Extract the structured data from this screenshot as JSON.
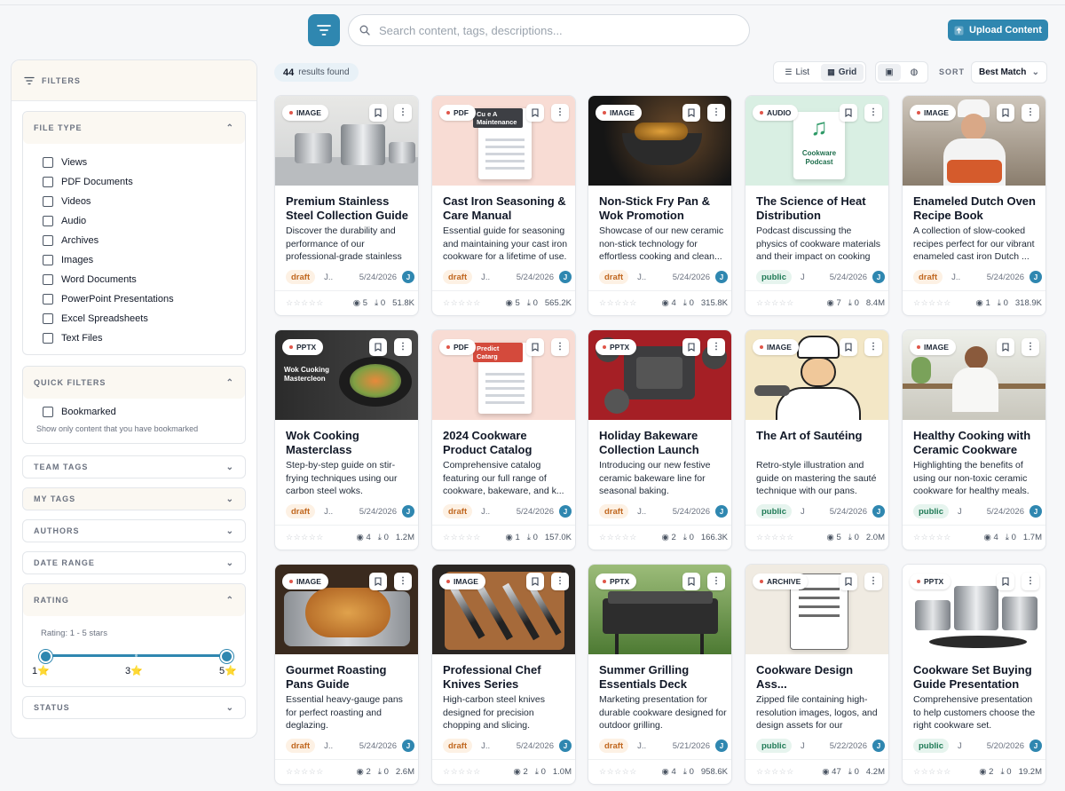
{
  "header": {
    "search_placeholder": "Search content, tags, descriptions...",
    "upload_label": "Upload Content"
  },
  "sidebar": {
    "title": "FILTERS",
    "file_type": {
      "title": "FILE TYPE",
      "options": [
        "Views",
        "PDF Documents",
        "Videos",
        "Audio",
        "Archives",
        "Images",
        "Word Documents",
        "PowerPoint Presentations",
        "Excel Spreadsheets",
        "Text Files"
      ]
    },
    "quick_filters": {
      "title": "QUICK FILTERS",
      "option": "Bookmarked",
      "hint": "Show only content that you have bookmarked"
    },
    "collapsed": [
      "TEAM TAGS",
      "MY TAGS",
      "AUTHORS",
      "DATE RANGE"
    ],
    "rating": {
      "title": "RATING",
      "label": "Rating: 1 - 5 stars",
      "min": "1⭐",
      "mid": "3⭐",
      "max": "5⭐",
      "range": [
        1,
        5
      ]
    },
    "status_title": "STATUS"
  },
  "toolbar": {
    "results_count": "44",
    "results_label": "results found",
    "list_label": "List",
    "grid_label": "Grid",
    "sort_label": "SORT",
    "sort_value": "Best Match"
  },
  "cards": [
    {
      "type": "IMAGE",
      "title": "Premium Stainless Steel Collection Guide",
      "desc": "Discover the durability and performance of our professional-grade stainless steel pots and pans.",
      "status": "draft",
      "author": "J..",
      "date": "5/24/2026",
      "views": "5",
      "downloads": "0",
      "size": "51.8K",
      "thumb_icon": "cookware-photo",
      "thumb_text": ""
    },
    {
      "type": "PDF",
      "title": "Cast Iron Seasoning & Care Manual",
      "desc": "Essential guide for seasoning and maintaining your cast iron cookware for a lifetime of use.",
      "status": "draft",
      "author": "J..",
      "date": "5/24/2026",
      "views": "5",
      "downloads": "0",
      "size": "565.2K",
      "thumb_icon": "document-icon",
      "thumb_text": "Cu e A Maintenance"
    },
    {
      "type": "IMAGE",
      "title": "Non-Stick Fry Pan & Wok Promotion",
      "desc": "Showcase of our new ceramic non-stick technology for effortless cooking and clean...",
      "status": "draft",
      "author": "J..",
      "date": "5/24/2026",
      "views": "4",
      "downloads": "0",
      "size": "315.8K",
      "thumb_icon": "wok-photo",
      "thumb_text": ""
    },
    {
      "type": "AUDIO",
      "title": "The Science of Heat Distribution",
      "desc": "Podcast discussing the physics of cookware materials and their impact on cooking",
      "status": "public",
      "author": "J",
      "date": "5/24/2026",
      "views": "7",
      "downloads": "0",
      "size": "8.4M",
      "thumb_icon": "music-note-icon",
      "thumb_text": "Cookware Podcast"
    },
    {
      "type": "IMAGE",
      "title": "Enameled Dutch Oven Recipe Book",
      "desc": "A collection of slow-cooked recipes perfect for our vibrant enameled cast iron Dutch ...",
      "status": "draft",
      "author": "J..",
      "date": "5/24/2026",
      "views": "1",
      "downloads": "0",
      "size": "318.9K",
      "thumb_icon": "chef-photo",
      "thumb_text": ""
    },
    {
      "type": "PPTX",
      "title": "Wok Cooking Masterclass Presentat...",
      "desc": "Step-by-step guide on stir-frying techniques using our carbon steel woks.",
      "status": "draft",
      "author": "J..",
      "date": "5/24/2026",
      "views": "4",
      "downloads": "0",
      "size": "1.2M",
      "thumb_icon": "wok-slide",
      "thumb_text": "Wok Cuoking Mastercleon"
    },
    {
      "type": "PDF",
      "title": "2024 Cookware Product Catalog",
      "desc": "Comprehensive catalog featuring our full range of cookware, bakeware, and k...",
      "status": "draft",
      "author": "J..",
      "date": "5/24/2026",
      "views": "1",
      "downloads": "0",
      "size": "157.0K",
      "thumb_icon": "document-icon",
      "thumb_text": "Predict Catarg"
    },
    {
      "type": "PPTX",
      "title": "Holiday Bakeware Collection Launch",
      "desc": "Introducing our new festive ceramic bakeware line for seasonal baking.",
      "status": "draft",
      "author": "J..",
      "date": "5/24/2026",
      "views": "2",
      "downloads": "0",
      "size": "166.3K",
      "thumb_icon": "bakeware-photo",
      "thumb_text": ""
    },
    {
      "type": "IMAGE",
      "title": "The Art of Sautéing",
      "desc": "Retro-style illustration and guide on mastering the sauté technique with our pans.",
      "status": "public",
      "author": "J",
      "date": "5/24/2026",
      "views": "5",
      "downloads": "0",
      "size": "2.0M",
      "thumb_icon": "chef-illustration",
      "thumb_text": ""
    },
    {
      "type": "IMAGE",
      "title": "Healthy Cooking with Ceramic Cookware",
      "desc": "Highlighting the benefits of using our non-toxic ceramic cookware for healthy meals.",
      "status": "public",
      "author": "J",
      "date": "5/24/2026",
      "views": "4",
      "downloads": "0",
      "size": "1.7M",
      "thumb_icon": "kitchen-photo",
      "thumb_text": ""
    },
    {
      "type": "IMAGE",
      "title": "Gourmet Roasting Pans Guide",
      "desc": "Essential heavy-gauge pans for perfect roasting and deglazing.",
      "status": "draft",
      "author": "J..",
      "date": "5/24/2026",
      "views": "2",
      "downloads": "0",
      "size": "2.6M",
      "thumb_icon": "roast-photo",
      "thumb_text": ""
    },
    {
      "type": "IMAGE",
      "title": "Professional Chef Knives Series",
      "desc": "High-carbon steel knives designed for precision chopping and slicing.",
      "status": "draft",
      "author": "J..",
      "date": "5/24/2026",
      "views": "2",
      "downloads": "0",
      "size": "1.0M",
      "thumb_icon": "knives-photo",
      "thumb_text": ""
    },
    {
      "type": "PPTX",
      "title": "Summer Grilling Essentials Deck",
      "desc": "Marketing presentation for durable cookware designed for outdoor grilling.",
      "status": "draft",
      "author": "J..",
      "date": "5/21/2026",
      "views": "4",
      "downloads": "0",
      "size": "958.6K",
      "thumb_icon": "grill-photo",
      "thumb_text": ""
    },
    {
      "type": "ARCHIVE",
      "title": "Cookware Design Ass...",
      "desc": "Zipped file containing high-resolution images, logos, and design assets for our cookware brand.",
      "status": "public",
      "author": "J",
      "date": "5/22/2026",
      "views": "47",
      "downloads": "0",
      "size": "4.2M",
      "thumb_icon": "archive-document-icon",
      "thumb_text": ""
    },
    {
      "type": "PPTX",
      "title": "Cookware Set Buying Guide Presentation",
      "desc": "Comprehensive presentation to help customers choose the right cookware set.",
      "status": "public",
      "author": "J",
      "date": "5/20/2026",
      "views": "2",
      "downloads": "0",
      "size": "19.2M",
      "thumb_icon": "cookware-set-photo",
      "thumb_text": ""
    }
  ],
  "colors": {
    "accent": "#2f87b0",
    "draft_bg": "#fdf1e4",
    "draft_fg": "#c0671f",
    "public_bg": "#e6f4ee",
    "public_fg": "#1f7a56"
  }
}
